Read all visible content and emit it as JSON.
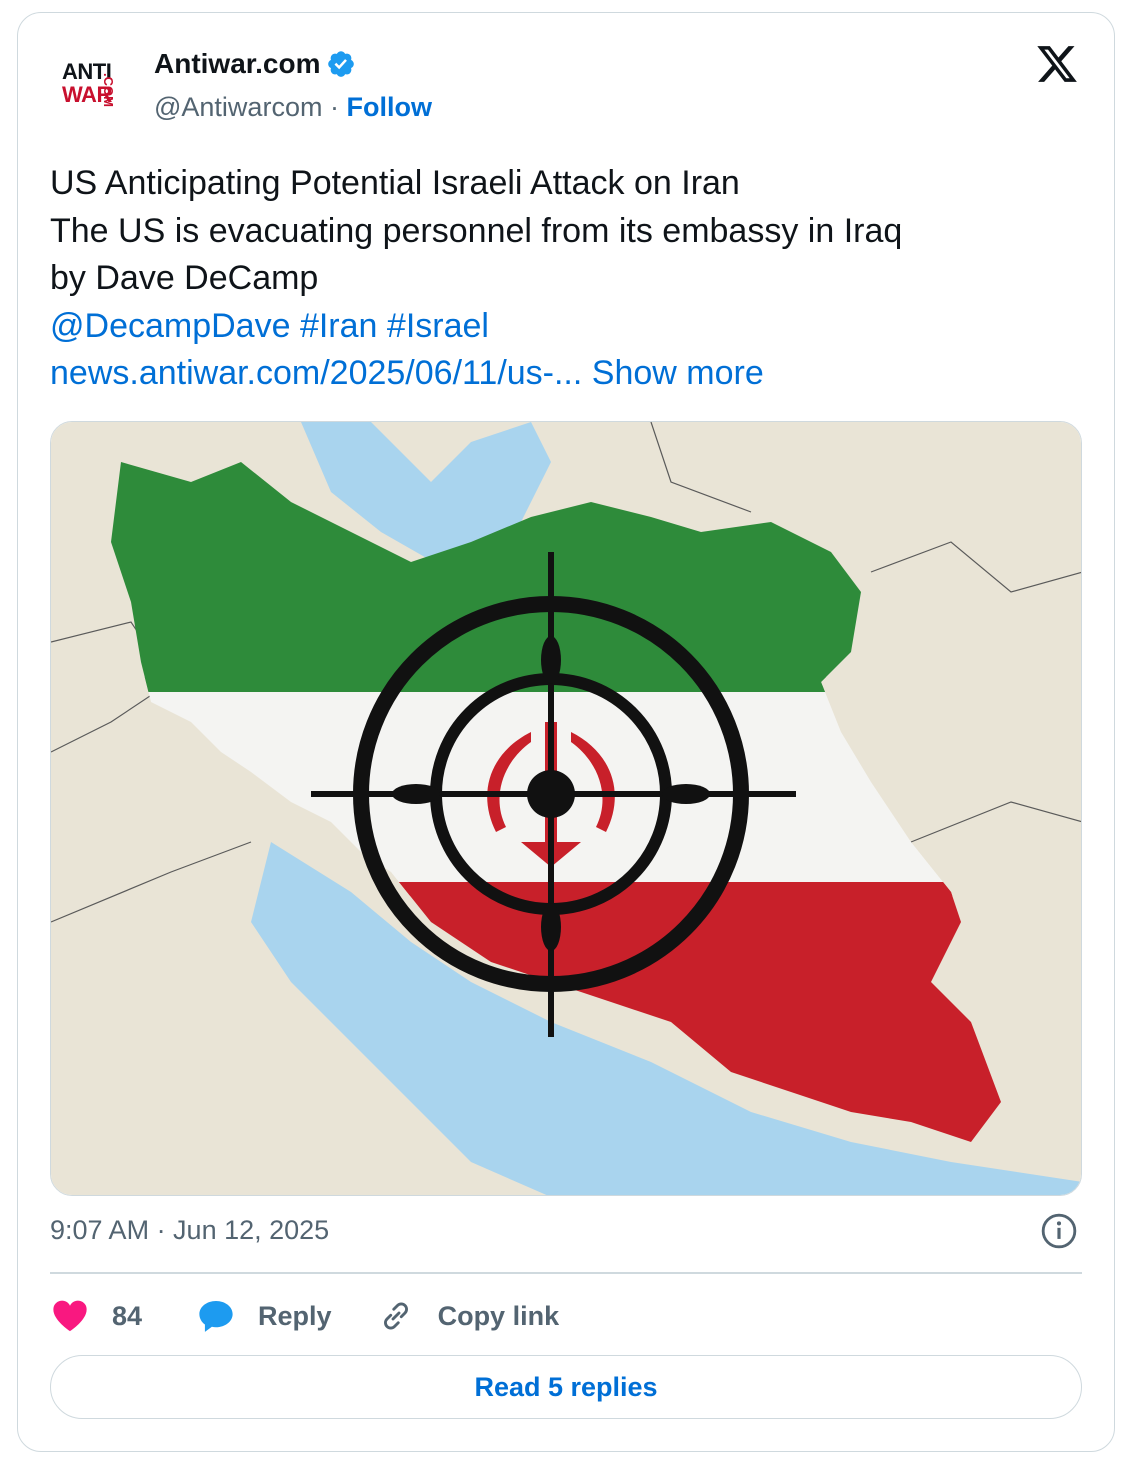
{
  "account": {
    "logo_line1": "ANTI",
    "logo_line2": "WAR",
    "logo_suffix": ".COM",
    "name": "Antiwar.com",
    "handle": "@Antiwarcom",
    "separator": "·",
    "follow_label": "Follow",
    "verified": true
  },
  "tweet": {
    "lines": [
      "US Anticipating Potential Israeli Attack on Iran",
      "The US is evacuating personnel from its embassy in Iraq",
      "by Dave DeCamp"
    ],
    "mention": "@DecampDave",
    "hashtags": [
      "#Iran",
      "#Israel"
    ],
    "url_text": "news.antiwar.com/2025/06/11/us-...",
    "show_more_label": "Show more",
    "timestamp": "9:07 AM · Jun 12, 2025"
  },
  "actions": {
    "likes": "84",
    "reply_label": "Reply",
    "copy_link_label": "Copy link"
  },
  "read_replies_label": "Read 5 replies",
  "icons": [
    "verified-icon",
    "x-logo-icon",
    "info-icon",
    "heart-icon",
    "reply-bubble-icon",
    "link-icon"
  ],
  "colors": {
    "link_blue": "#006fd6",
    "heart_pink": "#f91880",
    "reply_blue": "#1d9bf0",
    "muted_gray": "#536471",
    "flag_green": "#2e8b3a",
    "flag_red": "#c8202a"
  }
}
